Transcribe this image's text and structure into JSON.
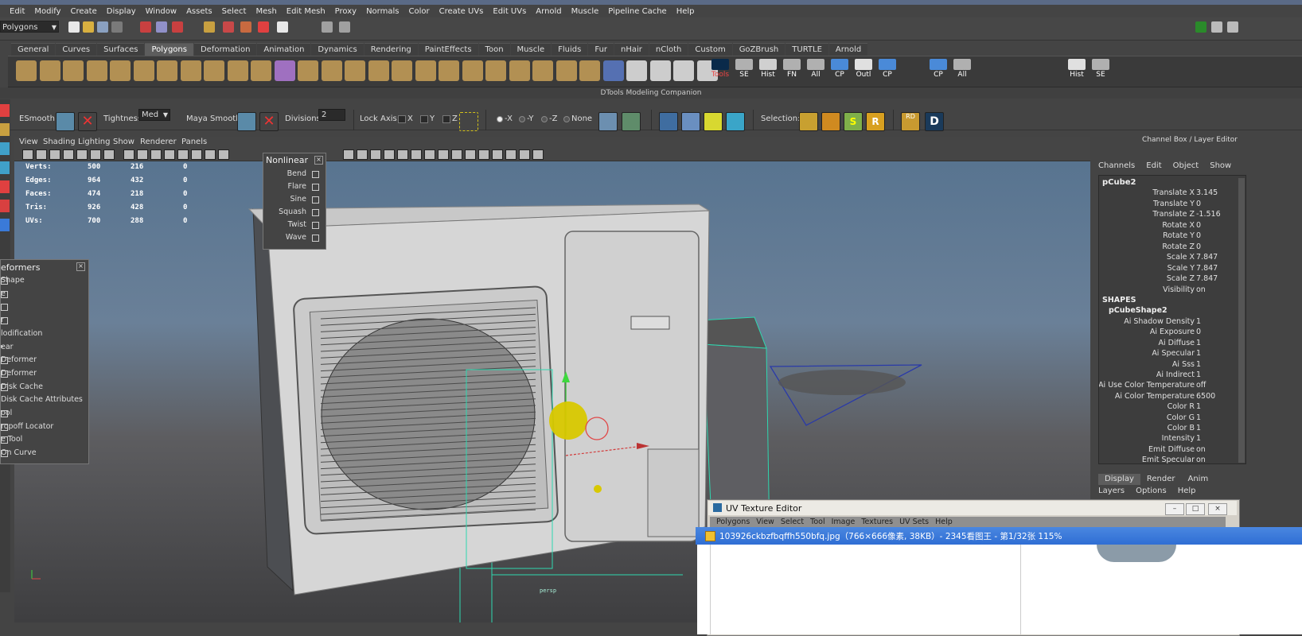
{
  "menubar": [
    "Edit",
    "Modify",
    "Create",
    "Display",
    "Window",
    "Assets",
    "Select",
    "Mesh",
    "Edit Mesh",
    "Proxy",
    "Normals",
    "Color",
    "Create UVs",
    "Edit UVs",
    "Arnold",
    "Muscle",
    "Pipeline Cache",
    "Help"
  ],
  "status": {
    "mode": "Polygons"
  },
  "shelf": {
    "tabs": [
      "General",
      "Curves",
      "Surfaces",
      "Polygons",
      "Deformation",
      "Animation",
      "Dynamics",
      "Rendering",
      "PaintEffects",
      "Toon",
      "Muscle",
      "Fluids",
      "Fur",
      "nHair",
      "nCloth",
      "Custom",
      "GoZBrush",
      "TURTLE",
      "Arnold"
    ],
    "active": "Polygons",
    "labels": [
      "Tools",
      "SE",
      "Hist",
      "FN",
      "All",
      "CP",
      "Outl",
      "CP",
      "CP",
      "All",
      "Hist",
      "SE"
    ]
  },
  "dtools": {
    "title": "DTools Modeling Companion",
    "esmooth": "ESmooth:",
    "tightness": "Tightness",
    "tightness_value": "Med",
    "maya_smooth": "Maya Smooth:",
    "divisions": "Divisions:",
    "divisions_value": "2",
    "lock_axis": "Lock Axis:",
    "axes": [
      "X",
      "Y",
      "Z"
    ],
    "mirror": [
      "-X",
      "-Y",
      "-Z",
      "None"
    ],
    "selection": "Selection:",
    "rd": "RD"
  },
  "viewport": {
    "menu": [
      "View",
      "Shading",
      "Lighting",
      "Show",
      "Renderer",
      "Panels"
    ],
    "hud": [
      {
        "label": "Verts:",
        "a": "500",
        "b": "216",
        "c": "0"
      },
      {
        "label": "Edges:",
        "a": "964",
        "b": "432",
        "c": "0"
      },
      {
        "label": "Faces:",
        "a": "474",
        "b": "218",
        "c": "0"
      },
      {
        "label": "Tris:",
        "a": "926",
        "b": "428",
        "c": "0"
      },
      {
        "label": "UVs:",
        "a": "700",
        "b": "288",
        "c": "0"
      }
    ],
    "corner_label": "persp"
  },
  "nonlinear": {
    "title": "Nonlinear",
    "items": [
      "Bend",
      "Flare",
      "Sine",
      "Squash",
      "Twist",
      "Wave"
    ]
  },
  "deformers": {
    "title": "eformers",
    "items": [
      "Shape",
      "e",
      "",
      "r",
      "lodification",
      "ear",
      "Deformer",
      "Deformer",
      "Disk Cache",
      "Disk Cache Attributes",
      "ool",
      "ropoff Locator",
      "e Tool",
      "On Curve"
    ]
  },
  "channel_box": {
    "title": "Channel Box / Layer Editor",
    "menu": [
      "Channels",
      "Edit",
      "Object",
      "Show"
    ],
    "object": "pCube2",
    "attrs": [
      {
        "name": "Translate X",
        "value": "3.145"
      },
      {
        "name": "Translate Y",
        "value": "0"
      },
      {
        "name": "Translate Z",
        "value": "-1.516"
      },
      {
        "name": "Rotate X",
        "value": "0"
      },
      {
        "name": "Rotate Y",
        "value": "0"
      },
      {
        "name": "Rotate Z",
        "value": "0"
      },
      {
        "name": "Scale X",
        "value": "7.847"
      },
      {
        "name": "Scale Y",
        "value": "7.847"
      },
      {
        "name": "Scale Z",
        "value": "7.847"
      },
      {
        "name": "Visibility",
        "value": "on"
      }
    ],
    "shapes_header": "SHAPES",
    "shape": "pCubeShape2",
    "shape_attrs": [
      {
        "name": "Ai Shadow Density",
        "value": "1"
      },
      {
        "name": "Ai Exposure",
        "value": "0"
      },
      {
        "name": "Ai Diffuse",
        "value": "1"
      },
      {
        "name": "Ai Specular",
        "value": "1"
      },
      {
        "name": "Ai Sss",
        "value": "1"
      },
      {
        "name": "Ai Indirect",
        "value": "1"
      },
      {
        "name": "Ai Use Color Temperature",
        "value": "off"
      },
      {
        "name": "Ai Color Temperature",
        "value": "6500"
      },
      {
        "name": "Color R",
        "value": "1"
      },
      {
        "name": "Color G",
        "value": "1"
      },
      {
        "name": "Color B",
        "value": "1"
      },
      {
        "name": "Intensity",
        "value": "1"
      },
      {
        "name": "Emit Diffuse",
        "value": "on"
      },
      {
        "name": "Emit Specular",
        "value": "on"
      }
    ],
    "layer_tabs": [
      "Display",
      "Render",
      "Anim"
    ],
    "layer_menu": [
      "Layers",
      "Options",
      "Help"
    ]
  },
  "uv_editor": {
    "title": "UV Texture Editor",
    "menu": [
      "Polygons",
      "View",
      "Select",
      "Tool",
      "Image",
      "Textures",
      "UV Sets",
      "Help"
    ]
  },
  "image_viewer": {
    "caption": "103926ckbzfbqffh550bfq.jpg（766×666像素, 38KB）- 2345看图王 - 第1/32张 115%"
  }
}
